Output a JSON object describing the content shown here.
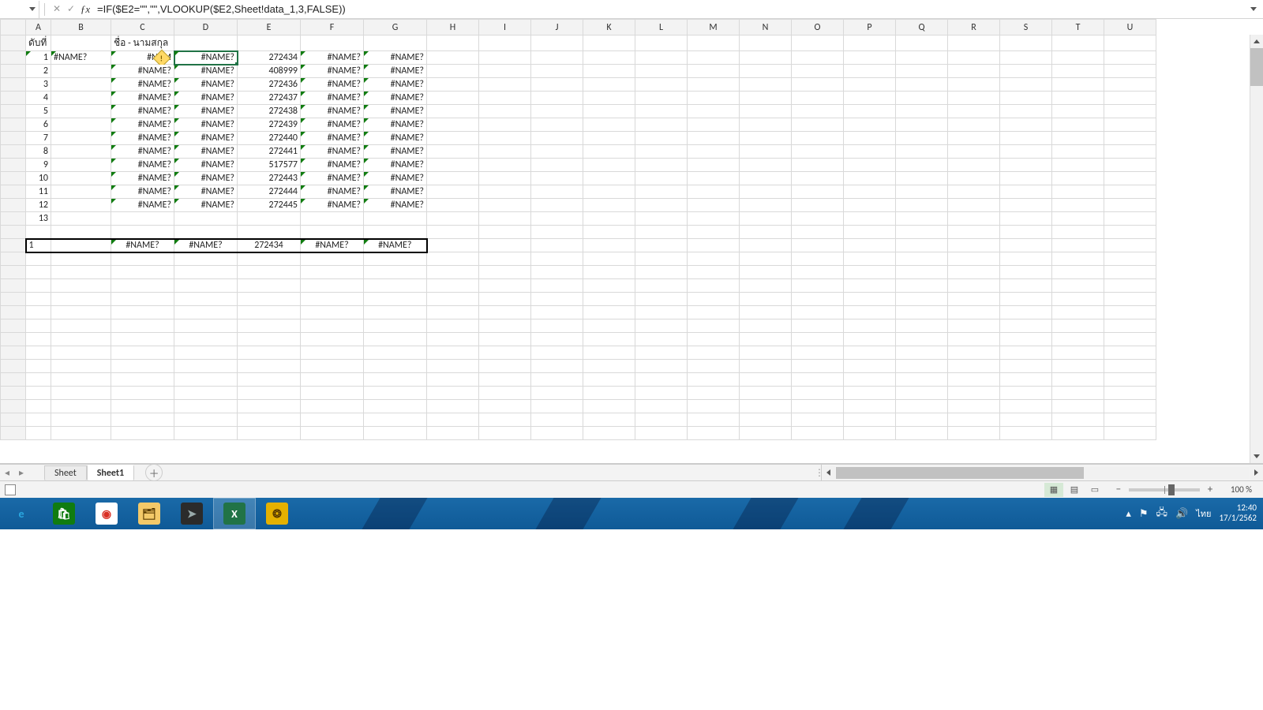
{
  "formula_bar": {
    "name_box": "",
    "formula": "=IF($E2=\"\",\"\",VLOOKUP($E2,Sheet!data_1,3,FALSE))"
  },
  "columns": [
    "A",
    "B",
    "C",
    "D",
    "E",
    "F",
    "G",
    "H",
    "I",
    "J",
    "K",
    "L",
    "M",
    "N",
    "O",
    "P",
    "Q",
    "R",
    "S",
    "T",
    "U"
  ],
  "header_row": {
    "A": "ดับที่",
    "C": "ชื่อ - นามสกุล"
  },
  "selected_cell": "D1",
  "data_rows": [
    {
      "A": "1",
      "B": "#NAME?",
      "C": "#NAM",
      "D": "#NAME?",
      "E": "272434",
      "F": "#NAME?",
      "G": "#NAME?"
    },
    {
      "A": "2",
      "B": "",
      "C": "#NAME?",
      "D": "#NAME?",
      "E": "408999",
      "F": "#NAME?",
      "G": "#NAME?"
    },
    {
      "A": "3",
      "B": "",
      "C": "#NAME?",
      "D": "#NAME?",
      "E": "272436",
      "F": "#NAME?",
      "G": "#NAME?"
    },
    {
      "A": "4",
      "B": "",
      "C": "#NAME?",
      "D": "#NAME?",
      "E": "272437",
      "F": "#NAME?",
      "G": "#NAME?"
    },
    {
      "A": "5",
      "B": "",
      "C": "#NAME?",
      "D": "#NAME?",
      "E": "272438",
      "F": "#NAME?",
      "G": "#NAME?"
    },
    {
      "A": "6",
      "B": "",
      "C": "#NAME?",
      "D": "#NAME?",
      "E": "272439",
      "F": "#NAME?",
      "G": "#NAME?"
    },
    {
      "A": "7",
      "B": "",
      "C": "#NAME?",
      "D": "#NAME?",
      "E": "272440",
      "F": "#NAME?",
      "G": "#NAME?"
    },
    {
      "A": "8",
      "B": "",
      "C": "#NAME?",
      "D": "#NAME?",
      "E": "272441",
      "F": "#NAME?",
      "G": "#NAME?"
    },
    {
      "A": "9",
      "B": "",
      "C": "#NAME?",
      "D": "#NAME?",
      "E": "517577",
      "F": "#NAME?",
      "G": "#NAME?"
    },
    {
      "A": "10",
      "B": "",
      "C": "#NAME?",
      "D": "#NAME?",
      "E": "272443",
      "F": "#NAME?",
      "G": "#NAME?"
    },
    {
      "A": "11",
      "B": "",
      "C": "#NAME?",
      "D": "#NAME?",
      "E": "272444",
      "F": "#NAME?",
      "G": "#NAME?"
    },
    {
      "A": "12",
      "B": "",
      "C": "#NAME?",
      "D": "#NAME?",
      "E": "272445",
      "F": "#NAME?",
      "G": "#NAME?"
    },
    {
      "A": "13",
      "B": "",
      "C": "",
      "D": "",
      "E": "",
      "F": "",
      "G": ""
    }
  ],
  "summary_row": {
    "A": "1",
    "B": "",
    "C": "#NAME?",
    "D": "#NAME?",
    "E": "272434",
    "F": "#NAME?",
    "G": "#NAME?"
  },
  "blank_rows_after": 14,
  "tabs": {
    "items": [
      "Sheet",
      "Sheet1"
    ],
    "active": "Sheet1"
  },
  "status": {
    "zoom": "100 %"
  },
  "taskbar": {
    "apps": [
      {
        "name": "internet-explorer",
        "glyph": "e",
        "bg": "#ffffff00",
        "fg": "#2aa8e0",
        "active": false
      },
      {
        "name": "store",
        "glyph": "🛍",
        "bg": "#107c10",
        "fg": "#fff",
        "active": false
      },
      {
        "name": "chrome",
        "glyph": "◉",
        "bg": "#ffffff",
        "fg": "#d93025",
        "active": false
      },
      {
        "name": "file-explorer",
        "glyph": "🗂",
        "bg": "#f3c969",
        "fg": "#5a3b00",
        "active": false
      },
      {
        "name": "app-dark",
        "glyph": "➤",
        "bg": "#2b2b2b",
        "fg": "#9aa",
        "active": false
      },
      {
        "name": "excel",
        "glyph": "X",
        "bg": "#217346",
        "fg": "#fff",
        "active": true
      },
      {
        "name": "app-gold",
        "glyph": "❂",
        "bg": "#e5b100",
        "fg": "#5a3b00",
        "active": false
      }
    ],
    "tray": {
      "lang": "ไทย",
      "time": "12:40",
      "date": "17/1/2562"
    }
  }
}
